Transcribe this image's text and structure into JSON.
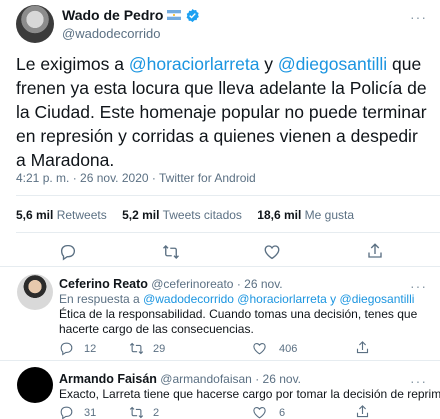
{
  "tweet": {
    "author_name": "Wado de Pedro",
    "author_handle": "@wadodecorrido",
    "text_parts": {
      "p1": "Le exigimos a ",
      "mention1": "@horaciorlarreta",
      "p2": " y ",
      "mention2": "@diegosantilli",
      "p3": " que frenen ya esta locura que lleva adelante la Policía de la Ciudad. Este homenaje popular no puede terminar en represión y corridas a quienes vienen a despedir a Maradona."
    },
    "time": "4:21 p. m.",
    "date": "26 nov. 2020",
    "source": "Twitter for Android",
    "meta_sep": " · ",
    "stats": {
      "retweets_count": "5,6 mil",
      "retweets_label": "Retweets",
      "quotes_count": "5,2 mil",
      "quotes_label": "Tweets citados",
      "likes_count": "18,6 mil",
      "likes_label": "Me gusta"
    },
    "more": "···"
  },
  "replies": [
    {
      "name": "Ceferino Reato",
      "handle": "@ceferinoreato",
      "date": "· 26 nov.",
      "replying_prefix": "En respuesta a ",
      "replying_to": "@wadodecorrido @horaciorlarreta y @diegosantilli",
      "text": "Ética de la responsabilidad. Cuando tomas una decisión, tenes que hacerte cargo de las consecuencias.",
      "replies": "12",
      "retweets": "29",
      "likes": "406",
      "more": "···"
    },
    {
      "name": "Armando Faisán",
      "handle": "@armandofaisan",
      "date": "· 26 nov.",
      "text": "Exacto, Larreta tiene que hacerse cargo por tomar la decisión de reprimir.",
      "replies": "31",
      "retweets": "2",
      "likes": "6",
      "more": "···"
    }
  ],
  "colors": {
    "accent": "#1b95e0",
    "text": "#0f1419",
    "muted": "#5b7083",
    "divider": "#e6ecf0",
    "verified": "#1da1f2"
  },
  "icons": [
    "reply-icon",
    "retweet-icon",
    "like-icon",
    "share-icon",
    "verified-badge-icon",
    "argentina-flag-icon",
    "more-options-icon"
  ]
}
